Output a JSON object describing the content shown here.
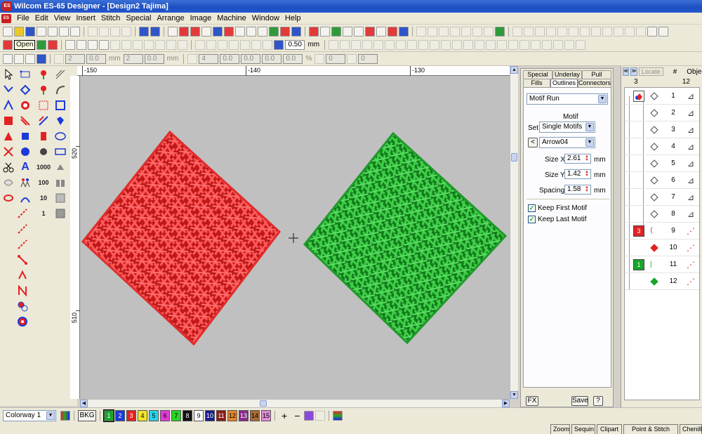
{
  "window": {
    "app_icon": "ES",
    "title": "Wilcom ES-65 Designer - [Design2        Tajima]"
  },
  "menu": {
    "doc_icon": "ES",
    "items": [
      "File",
      "Edit",
      "View",
      "Insert",
      "Stitch",
      "Special",
      "Arrange",
      "Image",
      "Machine",
      "Window",
      "Help"
    ]
  },
  "toolbar": {
    "tooltip": "Open",
    "zoom_value": "0.50",
    "zoom_unit": "mm",
    "dim_fields": [
      "0.0",
      "0.0",
      "0.0",
      "0.0",
      "0.0",
      "0.0"
    ],
    "dim_counts": [
      "2",
      "2",
      "4"
    ],
    "dim_unit": "mm",
    "percent_sign": "%",
    "angle_fields": [
      "0",
      "0"
    ]
  },
  "left_tools": {
    "text_a": "A",
    "count_1000": "1000",
    "count_100": "100",
    "count_10": "10",
    "count_1": "1"
  },
  "rulers": {
    "top": [
      "-150",
      "-140",
      "-130"
    ],
    "left": [
      "520",
      "510"
    ]
  },
  "design": {
    "red_color": "#e02d2d",
    "green_color": "#1f9a2a",
    "canvas_bg": "#c0c0c0"
  },
  "properties": {
    "tabs_row1": [
      "Special",
      "Underlay",
      "Pull Comp"
    ],
    "tabs_row2": [
      "Fills",
      "Outlines",
      "Connectors"
    ],
    "active_tab": "Outlines",
    "stitch_type": "Motif Run",
    "section_title": "Motif",
    "set_label": "Set",
    "set_value": "Single Motifs",
    "motif_value": "Arrow04",
    "prev_symbol": "<",
    "size_x_label": "Size X",
    "size_x_value": "2.61",
    "size_y_label": "Size Y",
    "size_y_value": "1.42",
    "spacing_label": "Spacing",
    "spacing_value": "1.58",
    "unit": "mm",
    "keep_first_label": "Keep First Motif",
    "keep_first_checked": true,
    "keep_last_label": "Keep Last Motif",
    "keep_last_checked": true,
    "fx_label": "FX",
    "save_label": "Save",
    "help_label": "?"
  },
  "sequence": {
    "locate_label": "Locate",
    "col_hash": "#",
    "col_object": "Object",
    "group_count": "3",
    "object_count": "12",
    "rows": [
      {
        "num": "1",
        "marker": "rect"
      },
      {
        "num": "2",
        "marker": "diamond"
      },
      {
        "num": "3",
        "marker": "diamond"
      },
      {
        "num": "4",
        "marker": "diamond"
      },
      {
        "num": "5",
        "marker": "diamond"
      },
      {
        "num": "6",
        "marker": "diamond"
      },
      {
        "num": "7",
        "marker": "diamond"
      },
      {
        "num": "8",
        "marker": "diamond"
      },
      {
        "num": "9",
        "marker": "red-group",
        "group_label": "3"
      },
      {
        "num": "10",
        "marker": "red"
      },
      {
        "num": "11",
        "marker": "green-group",
        "group_label": "1"
      },
      {
        "num": "12",
        "marker": "green"
      }
    ]
  },
  "colorway": {
    "label": "Colorway 1",
    "bkg_label": "BKG",
    "swatches": [
      {
        "n": "1",
        "color": "#1aa52c"
      },
      {
        "n": "2",
        "color": "#1c3ad8"
      },
      {
        "n": "3",
        "color": "#e22222"
      },
      {
        "n": "4",
        "color": "#f2e52a"
      },
      {
        "n": "5",
        "color": "#2ad2e8"
      },
      {
        "n": "6",
        "color": "#e23ad8"
      },
      {
        "n": "7",
        "color": "#2ad22a"
      },
      {
        "n": "8",
        "color": "#111111"
      },
      {
        "n": "9",
        "color": "#ffffff"
      },
      {
        "n": "10",
        "color": "#1c1c8a"
      },
      {
        "n": "11",
        "color": "#8a1c1c"
      },
      {
        "n": "12",
        "color": "#e2862a"
      },
      {
        "n": "13",
        "color": "#8a2a8a"
      },
      {
        "n": "14",
        "color": "#a86a3a"
      },
      {
        "n": "15",
        "color": "#e28ad8"
      }
    ],
    "plus": "+",
    "minus": "−"
  },
  "status_tabs": [
    "Zoom",
    "Sequin",
    "Clipart",
    "Point & Stitch (TM)",
    "Chenille"
  ]
}
